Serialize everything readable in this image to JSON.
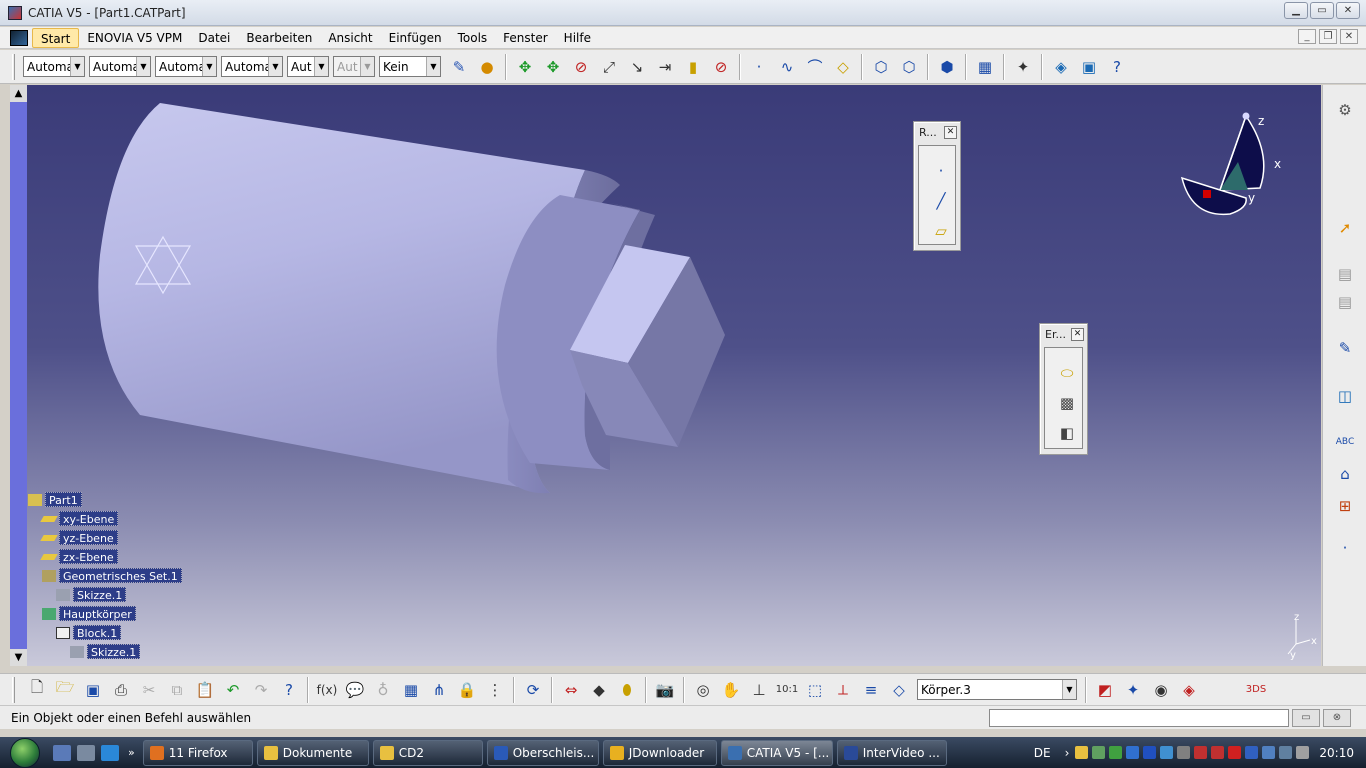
{
  "window": {
    "title": "CATIA V5 - [Part1.CATPart]"
  },
  "menu": {
    "items": [
      "Start",
      "ENOVIA V5 VPM",
      "Datei",
      "Bearbeiten",
      "Ansicht",
      "Einfügen",
      "Tools",
      "Fenster",
      "Hilfe"
    ]
  },
  "toolbar": {
    "combos": [
      "Automa",
      "Automa",
      "Automa",
      "Automa",
      "Aut",
      "Aut",
      "Kein"
    ],
    "body_combo": "Körper.3"
  },
  "panels": {
    "reference": {
      "title": "R..."
    },
    "generate": {
      "title": "Er..."
    }
  },
  "compass": {
    "x": "x",
    "y": "y",
    "z": "z"
  },
  "mini_axis": {
    "x": "x",
    "y": "y",
    "z": "z"
  },
  "tree": {
    "nodes": [
      "Part1",
      "xy-Ebene",
      "yz-Ebene",
      "zx-Ebene",
      "Geometrisches Set.1",
      "Skizze.1",
      "Hauptkörper",
      "Block.1",
      "Skizze.1"
    ]
  },
  "status": {
    "message": "Ein Objekt oder einen Befehl auswählen"
  },
  "taskbar": {
    "items": [
      "11 Firefox",
      "Dokumente",
      "CD2",
      "Oberschleis...",
      "JDownloader",
      "CATIA V5 - [...",
      "InterVideo ..."
    ],
    "lang": "DE",
    "clock": "20:10"
  },
  "colors": {
    "viewport_top": "#3a3b78",
    "viewport_bottom": "#c9c9da",
    "tree_label_bg": "#2d3d88",
    "part_color": "#b8b8e6"
  }
}
